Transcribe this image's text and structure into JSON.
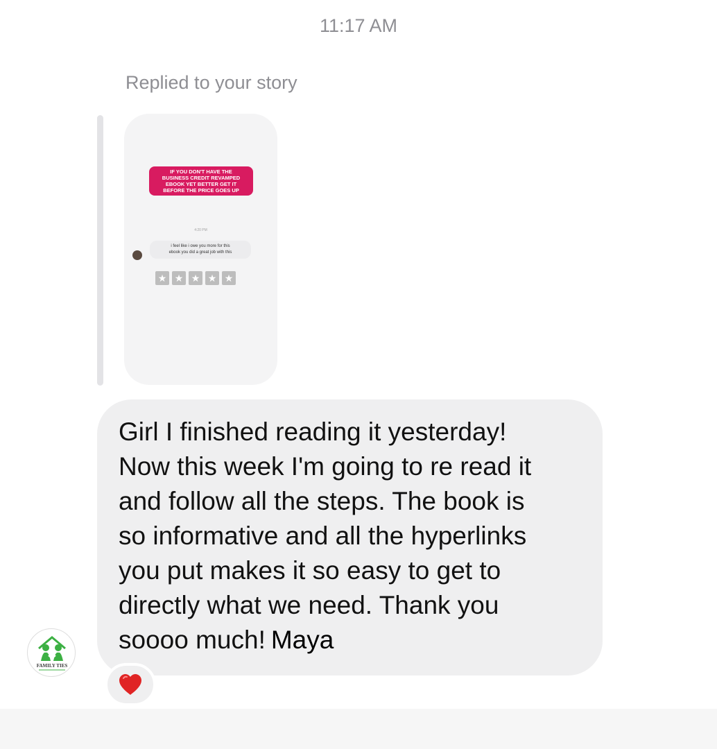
{
  "header": {
    "timestamp": "11:17 AM"
  },
  "story_reply": {
    "label": "Replied to your story",
    "preview": {
      "banner_lines": [
        "IF YOU DON'T HAVE THE",
        "BUSINESS CREDIT REVAMPED",
        "EBOOK YET BETTER GET IT",
        "BEFORE THE PRICE GOES UP"
      ],
      "time": "4:20 PM",
      "message_lines": [
        "i feel like i owe you more for this",
        "ebook you did a great job with this"
      ],
      "rating_max": 5,
      "banner_color": "#d81b60"
    }
  },
  "message": {
    "lines": [
      "Girl I finished reading it yesterday!",
      "Now this week I'm going to re read it",
      "and follow all the steps. The book is",
      "so informative and all the hyperlinks",
      "you put makes it so easy to get to",
      "directly what we need. Thank you",
      "soooo much!"
    ],
    "signature": "Maya",
    "bubble_color": "#efeff0"
  },
  "sender": {
    "avatar_text": "FAMILY TIES",
    "avatar_icon": "family-ties-logo-icon",
    "logo_color": "#3cb043"
  },
  "reaction": {
    "icon": "red-heart-icon",
    "color": "#e02424"
  }
}
